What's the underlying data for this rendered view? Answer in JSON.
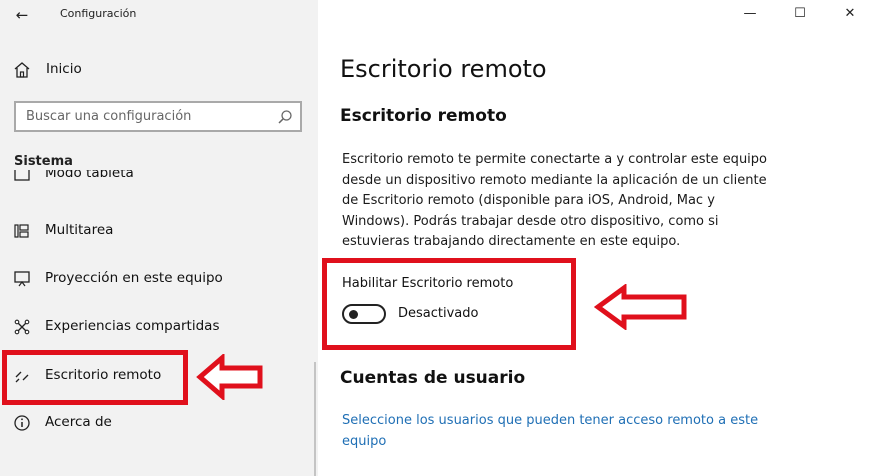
{
  "window": {
    "title": "Configuración",
    "back_label": "←",
    "minimize_label": "—",
    "maximize_label": "☐",
    "close_label": "✕"
  },
  "sidebar": {
    "home": {
      "label": "Inicio",
      "icon": "home-icon"
    },
    "search": {
      "placeholder": "Buscar una configuración",
      "icon": "search-icon"
    },
    "section_title": "Sistema",
    "items": [
      {
        "label": "Modo tableta",
        "icon": "tablet-mode-icon"
      },
      {
        "label": "Multitarea",
        "icon": "multitasking-icon"
      },
      {
        "label": "Proyección en este equipo",
        "icon": "projection-icon"
      },
      {
        "label": "Experiencias compartidas",
        "icon": "shared-experiences-icon"
      },
      {
        "label": "Escritorio remoto",
        "icon": "remote-desktop-icon",
        "selected": true
      },
      {
        "label": "Acerca de",
        "icon": "info-icon"
      }
    ]
  },
  "main": {
    "page_title": "Escritorio remoto",
    "section_title": "Escritorio remoto",
    "description": "Escritorio remoto te permite conectarte a y controlar este equipo desde un dispositivo remoto mediante la aplicación de un cliente de Escritorio remoto (disponible para iOS, Android, Mac y Windows). Podrás trabajar desde otro dispositivo, como si estuvieras trabajando directamente en este equipo.",
    "toggle": {
      "label": "Habilitar Escritorio remoto",
      "state_label": "Desactivado",
      "on": false
    },
    "users_title": "Cuentas de usuario",
    "users_link": "Seleccione los usuarios que pueden tener acceso remoto a este equipo"
  },
  "colors": {
    "highlight_red": "#e0101c",
    "link_blue": "#1f6fb5",
    "sidebar_bg": "#f2f2f2"
  }
}
